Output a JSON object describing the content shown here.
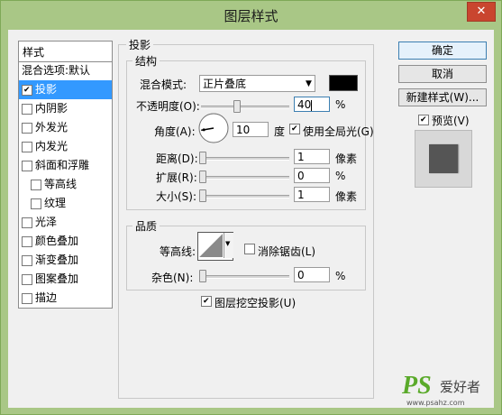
{
  "window": {
    "title": "图层样式",
    "close_glyph": "✕"
  },
  "style_list": {
    "header": "样式",
    "items": [
      {
        "label": "混合选项:默认",
        "checkbox": false,
        "checked": false,
        "selected": false,
        "sub": false
      },
      {
        "label": "投影",
        "checkbox": true,
        "checked": true,
        "selected": true,
        "sub": false
      },
      {
        "label": "内阴影",
        "checkbox": true,
        "checked": false,
        "selected": false,
        "sub": false
      },
      {
        "label": "外发光",
        "checkbox": true,
        "checked": false,
        "selected": false,
        "sub": false
      },
      {
        "label": "内发光",
        "checkbox": true,
        "checked": false,
        "selected": false,
        "sub": false
      },
      {
        "label": "斜面和浮雕",
        "checkbox": true,
        "checked": false,
        "selected": false,
        "sub": false
      },
      {
        "label": "等高线",
        "checkbox": true,
        "checked": false,
        "selected": false,
        "sub": true
      },
      {
        "label": "纹理",
        "checkbox": true,
        "checked": false,
        "selected": false,
        "sub": true
      },
      {
        "label": "光泽",
        "checkbox": true,
        "checked": false,
        "selected": false,
        "sub": false
      },
      {
        "label": "颜色叠加",
        "checkbox": true,
        "checked": false,
        "selected": false,
        "sub": false
      },
      {
        "label": "渐变叠加",
        "checkbox": true,
        "checked": false,
        "selected": false,
        "sub": false
      },
      {
        "label": "图案叠加",
        "checkbox": true,
        "checked": false,
        "selected": false,
        "sub": false
      },
      {
        "label": "描边",
        "checkbox": true,
        "checked": false,
        "selected": false,
        "sub": false
      }
    ]
  },
  "drop_shadow": {
    "group_title": "投影",
    "structure": {
      "title": "结构",
      "blend_mode_label": "混合模式:",
      "blend_mode_value": "正片叠底",
      "shadow_color": "#000000",
      "opacity_label": "不透明度(O):",
      "opacity_value": "40",
      "opacity_unit": "%",
      "angle_label": "角度(A):",
      "angle_value": "10",
      "angle_unit": "度",
      "global_light_label": "使用全局光(G)",
      "global_light_checked": true,
      "distance_label": "距离(D):",
      "distance_value": "1",
      "distance_unit": "像素",
      "spread_label": "扩展(R):",
      "spread_value": "0",
      "spread_unit": "%",
      "size_label": "大小(S):",
      "size_value": "1",
      "size_unit": "像素"
    },
    "quality": {
      "title": "品质",
      "contour_label": "等高线:",
      "anti_alias_label": "消除锯齿(L)",
      "anti_alias_checked": false,
      "noise_label": "杂色(N):",
      "noise_value": "0",
      "noise_unit": "%"
    },
    "knockout_label": "图层挖空投影(U)",
    "knockout_checked": true
  },
  "buttons": {
    "ok": "确定",
    "cancel": "取消",
    "new_style": "新建样式(W)...",
    "preview_label": "预览(V)",
    "preview_checked": true
  },
  "watermark": {
    "ps": "PS",
    "site_name": "爱好者",
    "url": "www.psahz.com"
  }
}
